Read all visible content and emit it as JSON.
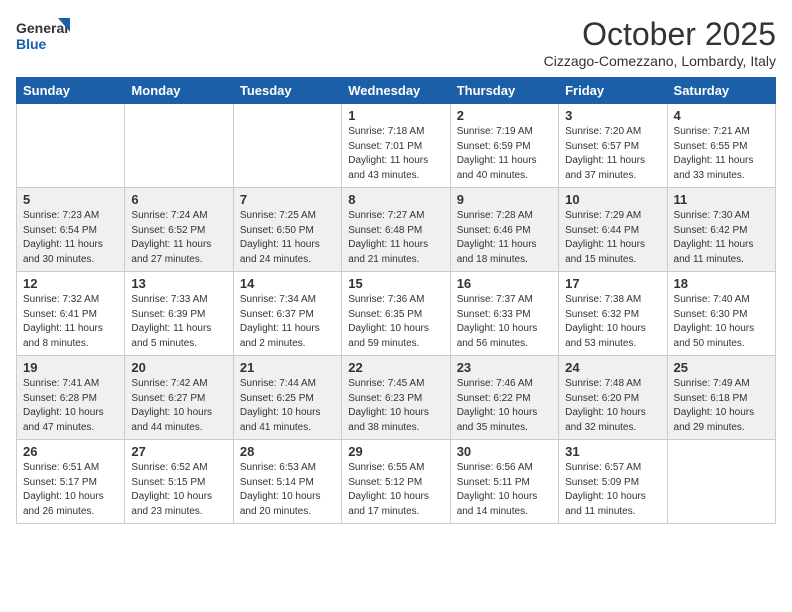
{
  "logo": {
    "line1": "General",
    "line2": "Blue"
  },
  "title": "October 2025",
  "location": "Cizzago-Comezzano, Lombardy, Italy",
  "weekdays": [
    "Sunday",
    "Monday",
    "Tuesday",
    "Wednesday",
    "Thursday",
    "Friday",
    "Saturday"
  ],
  "weeks": [
    [
      {
        "day": "",
        "info": ""
      },
      {
        "day": "",
        "info": ""
      },
      {
        "day": "",
        "info": ""
      },
      {
        "day": "1",
        "info": "Sunrise: 7:18 AM\nSunset: 7:01 PM\nDaylight: 11 hours\nand 43 minutes."
      },
      {
        "day": "2",
        "info": "Sunrise: 7:19 AM\nSunset: 6:59 PM\nDaylight: 11 hours\nand 40 minutes."
      },
      {
        "day": "3",
        "info": "Sunrise: 7:20 AM\nSunset: 6:57 PM\nDaylight: 11 hours\nand 37 minutes."
      },
      {
        "day": "4",
        "info": "Sunrise: 7:21 AM\nSunset: 6:55 PM\nDaylight: 11 hours\nand 33 minutes."
      }
    ],
    [
      {
        "day": "5",
        "info": "Sunrise: 7:23 AM\nSunset: 6:54 PM\nDaylight: 11 hours\nand 30 minutes."
      },
      {
        "day": "6",
        "info": "Sunrise: 7:24 AM\nSunset: 6:52 PM\nDaylight: 11 hours\nand 27 minutes."
      },
      {
        "day": "7",
        "info": "Sunrise: 7:25 AM\nSunset: 6:50 PM\nDaylight: 11 hours\nand 24 minutes."
      },
      {
        "day": "8",
        "info": "Sunrise: 7:27 AM\nSunset: 6:48 PM\nDaylight: 11 hours\nand 21 minutes."
      },
      {
        "day": "9",
        "info": "Sunrise: 7:28 AM\nSunset: 6:46 PM\nDaylight: 11 hours\nand 18 minutes."
      },
      {
        "day": "10",
        "info": "Sunrise: 7:29 AM\nSunset: 6:44 PM\nDaylight: 11 hours\nand 15 minutes."
      },
      {
        "day": "11",
        "info": "Sunrise: 7:30 AM\nSunset: 6:42 PM\nDaylight: 11 hours\nand 11 minutes."
      }
    ],
    [
      {
        "day": "12",
        "info": "Sunrise: 7:32 AM\nSunset: 6:41 PM\nDaylight: 11 hours\nand 8 minutes."
      },
      {
        "day": "13",
        "info": "Sunrise: 7:33 AM\nSunset: 6:39 PM\nDaylight: 11 hours\nand 5 minutes."
      },
      {
        "day": "14",
        "info": "Sunrise: 7:34 AM\nSunset: 6:37 PM\nDaylight: 11 hours\nand 2 minutes."
      },
      {
        "day": "15",
        "info": "Sunrise: 7:36 AM\nSunset: 6:35 PM\nDaylight: 10 hours\nand 59 minutes."
      },
      {
        "day": "16",
        "info": "Sunrise: 7:37 AM\nSunset: 6:33 PM\nDaylight: 10 hours\nand 56 minutes."
      },
      {
        "day": "17",
        "info": "Sunrise: 7:38 AM\nSunset: 6:32 PM\nDaylight: 10 hours\nand 53 minutes."
      },
      {
        "day": "18",
        "info": "Sunrise: 7:40 AM\nSunset: 6:30 PM\nDaylight: 10 hours\nand 50 minutes."
      }
    ],
    [
      {
        "day": "19",
        "info": "Sunrise: 7:41 AM\nSunset: 6:28 PM\nDaylight: 10 hours\nand 47 minutes."
      },
      {
        "day": "20",
        "info": "Sunrise: 7:42 AM\nSunset: 6:27 PM\nDaylight: 10 hours\nand 44 minutes."
      },
      {
        "day": "21",
        "info": "Sunrise: 7:44 AM\nSunset: 6:25 PM\nDaylight: 10 hours\nand 41 minutes."
      },
      {
        "day": "22",
        "info": "Sunrise: 7:45 AM\nSunset: 6:23 PM\nDaylight: 10 hours\nand 38 minutes."
      },
      {
        "day": "23",
        "info": "Sunrise: 7:46 AM\nSunset: 6:22 PM\nDaylight: 10 hours\nand 35 minutes."
      },
      {
        "day": "24",
        "info": "Sunrise: 7:48 AM\nSunset: 6:20 PM\nDaylight: 10 hours\nand 32 minutes."
      },
      {
        "day": "25",
        "info": "Sunrise: 7:49 AM\nSunset: 6:18 PM\nDaylight: 10 hours\nand 29 minutes."
      }
    ],
    [
      {
        "day": "26",
        "info": "Sunrise: 6:51 AM\nSunset: 5:17 PM\nDaylight: 10 hours\nand 26 minutes."
      },
      {
        "day": "27",
        "info": "Sunrise: 6:52 AM\nSunset: 5:15 PM\nDaylight: 10 hours\nand 23 minutes."
      },
      {
        "day": "28",
        "info": "Sunrise: 6:53 AM\nSunset: 5:14 PM\nDaylight: 10 hours\nand 20 minutes."
      },
      {
        "day": "29",
        "info": "Sunrise: 6:55 AM\nSunset: 5:12 PM\nDaylight: 10 hours\nand 17 minutes."
      },
      {
        "day": "30",
        "info": "Sunrise: 6:56 AM\nSunset: 5:11 PM\nDaylight: 10 hours\nand 14 minutes."
      },
      {
        "day": "31",
        "info": "Sunrise: 6:57 AM\nSunset: 5:09 PM\nDaylight: 10 hours\nand 11 minutes."
      },
      {
        "day": "",
        "info": ""
      }
    ]
  ]
}
